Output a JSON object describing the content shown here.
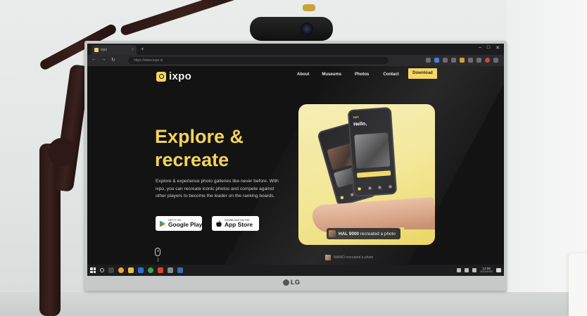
{
  "browser": {
    "tab_title": "ixpo",
    "tab_close": "×",
    "new_tab": "+",
    "url": "https://www.ixpo.io",
    "nav_back": "←",
    "nav_forward": "→",
    "nav_reload": "↻",
    "window_min": "–",
    "window_max": "□",
    "window_close": "✕"
  },
  "site": {
    "logo_text": "ixpo",
    "nav": {
      "about": "About",
      "museums": "Museums",
      "photos": "Photos",
      "contact": "Contact",
      "download": "Download"
    },
    "hero": {
      "title_line1": "Explore &",
      "title_line2": "recreate",
      "description": "Explore & experience photo galleries like never before. With ixpo, you can recreate iconic photos and compete against other players to become the leader on the ranking boards."
    },
    "stores": {
      "google_small": "GET IT ON",
      "google_big": "Google Play",
      "apple_small": "Download on the",
      "apple_big": "App Store"
    },
    "app_preview": {
      "header": "ixpo",
      "greeting": "Hello,",
      "toast_name": "HAL 9000",
      "toast_action": "recreated a photo",
      "feed_name": "NANIO",
      "feed_action": "recreated a photo"
    }
  },
  "taskbar": {
    "time": "12:09",
    "date": "1/12/2022"
  },
  "monitor": {
    "brand": "LG"
  },
  "colors": {
    "accent_yellow": "#f3d45b",
    "site_bg": "#131314",
    "text_light": "#e6e6e6"
  }
}
